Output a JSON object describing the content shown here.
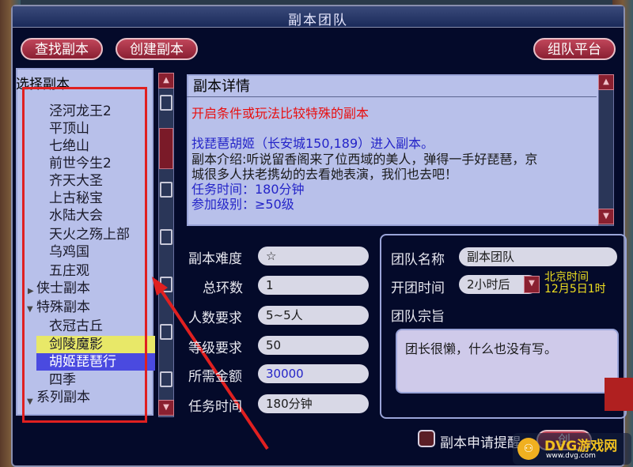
{
  "window": {
    "title": "副本团队"
  },
  "toolbar": {
    "find_label": "查找副本",
    "create_label": "创建副本",
    "team_platform_label": "组队平台"
  },
  "list": {
    "header": "选择副本",
    "items": [
      {
        "label": "泾河龙王2",
        "level": "sub"
      },
      {
        "label": "平顶山",
        "level": "sub"
      },
      {
        "label": "七绝山",
        "level": "sub"
      },
      {
        "label": "前世今生2",
        "level": "sub"
      },
      {
        "label": "齐天大圣",
        "level": "sub"
      },
      {
        "label": "上古秘宝",
        "level": "sub"
      },
      {
        "label": "水陆大会",
        "level": "sub"
      },
      {
        "label": "天火之殇上部",
        "level": "sub"
      },
      {
        "label": "乌鸡国",
        "level": "sub"
      },
      {
        "label": "五庄观",
        "level": "sub"
      },
      {
        "label": "侠士副本",
        "level": "cat"
      },
      {
        "label": "特殊副本",
        "level": "cat"
      },
      {
        "label": "衣冠古丘",
        "level": "sub"
      },
      {
        "label": "剑陵魔影",
        "level": "sub"
      },
      {
        "label": "胡姬琵琶行",
        "level": "sub"
      },
      {
        "label": "四季",
        "level": "sub"
      },
      {
        "label": "系列副本",
        "level": "cat"
      }
    ]
  },
  "detail": {
    "title": "副本详情",
    "condition": "开启条件或玩法比较特殊的副本",
    "npc_line": "找琵琶胡姬（长安城150,189）进入副本。",
    "intro_1": "副本介绍:听说留香阁来了位西域的美人，弹得一手好琵琶，京",
    "intro_2": "城很多人扶老携幼的去看她表演，我们也去吧！",
    "time": "任务时间：180分钟",
    "level": "参加级别：≥50级"
  },
  "form": {
    "difficulty_label": "副本难度",
    "difficulty_value": "☆",
    "rings_label": "总环数",
    "rings_value": "1",
    "people_label": "人数要求",
    "people_value": "5~5人",
    "level_label": "等级要求",
    "level_value": "50",
    "gold_label": "所需金额",
    "gold_value": "30000",
    "time_label": "任务时间",
    "time_value": "180分钟"
  },
  "team": {
    "name_label": "团队名称",
    "name_value": "副本团队",
    "open_label": "开团时间",
    "open_value": "2小时后",
    "beijing_1": "北京时间",
    "beijing_2": "12月5日1时",
    "motto_label": "团队宗旨",
    "motto_value": "团长很懒，什么也没有写。"
  },
  "bottom": {
    "apply_label": "副本申请提醒",
    "btn_label": "创"
  },
  "watermark": {
    "text": "DVG游戏网",
    "sub": "www.dvg.com"
  },
  "colors": {
    "accent_red": "#e81010",
    "link_blue": "#2424c8",
    "button": "#a83246"
  }
}
